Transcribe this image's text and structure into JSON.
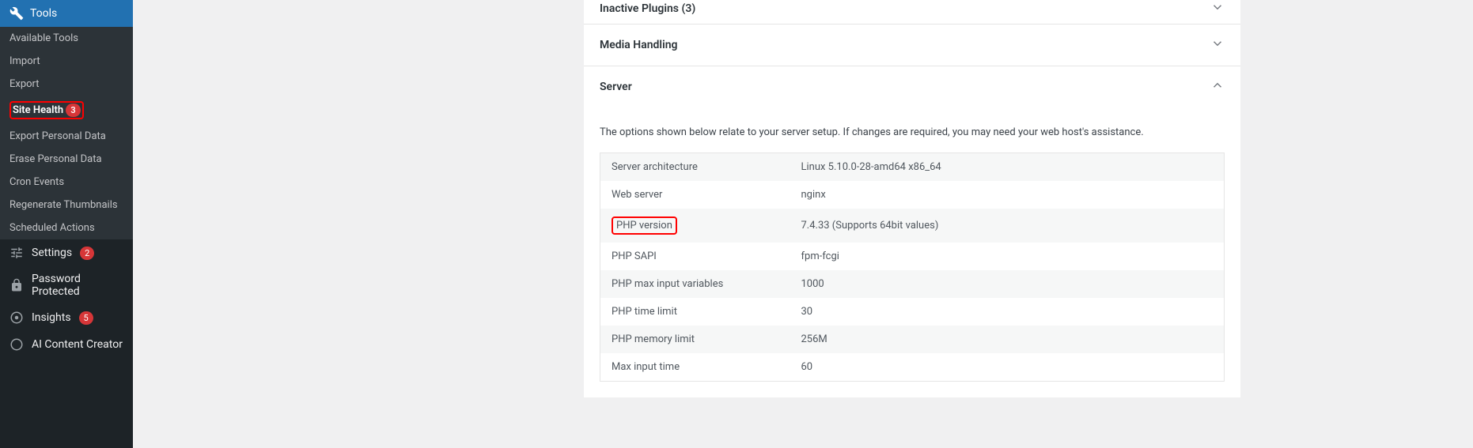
{
  "sidebar": {
    "tools_header": "Tools",
    "submenu": [
      "Available Tools",
      "Import",
      "Export",
      "Site Health",
      "Export Personal Data",
      "Erase Personal Data",
      "Cron Events",
      "Regenerate Thumbnails",
      "Scheduled Actions"
    ],
    "site_health_badge": "3",
    "settings": "Settings",
    "settings_badge": "2",
    "password_protected": "Password Protected",
    "insights": "Insights",
    "insights_badge": "5",
    "ai_content_creator": "AI Content Creator"
  },
  "accordions": {
    "inactive_plugins": "Inactive Plugins (3)",
    "media_handling": "Media Handling",
    "server": "Server"
  },
  "server": {
    "description": "The options shown below relate to your server setup. If changes are required, you may need your web host's assistance.",
    "rows": [
      {
        "label": "Server architecture",
        "value": "Linux 5.10.0-28-amd64 x86_64"
      },
      {
        "label": "Web server",
        "value": "nginx"
      },
      {
        "label": "PHP version",
        "value": "7.4.33 (Supports 64bit values)"
      },
      {
        "label": "PHP SAPI",
        "value": "fpm-fcgi"
      },
      {
        "label": "PHP max input variables",
        "value": "1000"
      },
      {
        "label": "PHP time limit",
        "value": "30"
      },
      {
        "label": "PHP memory limit",
        "value": "256M"
      },
      {
        "label": "Max input time",
        "value": "60"
      }
    ]
  }
}
